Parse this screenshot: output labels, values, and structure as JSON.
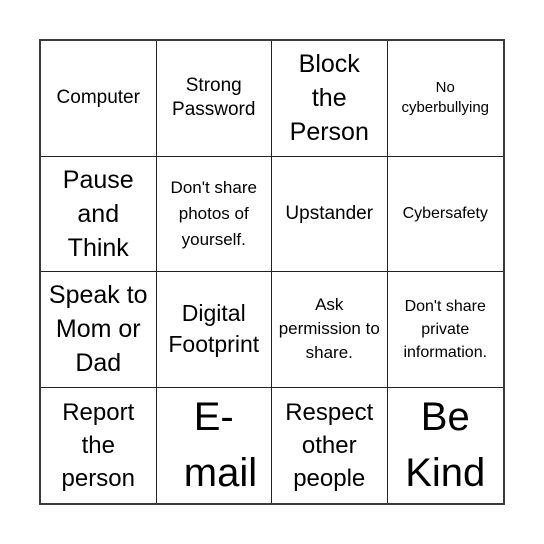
{
  "board": {
    "cells": [
      "Computer",
      "Strong Password",
      "Block the Person",
      "No cyberbullying",
      "Pause and Think",
      "Don't share photos of yourself.",
      "Upstander",
      "Cybersafety",
      "Speak to Mom or Dad",
      "Digital Footprint",
      "Ask permission to share.",
      "Don't share private information.",
      "Report the person",
      "E-mail",
      "Respect other people",
      "Be Kind"
    ]
  }
}
